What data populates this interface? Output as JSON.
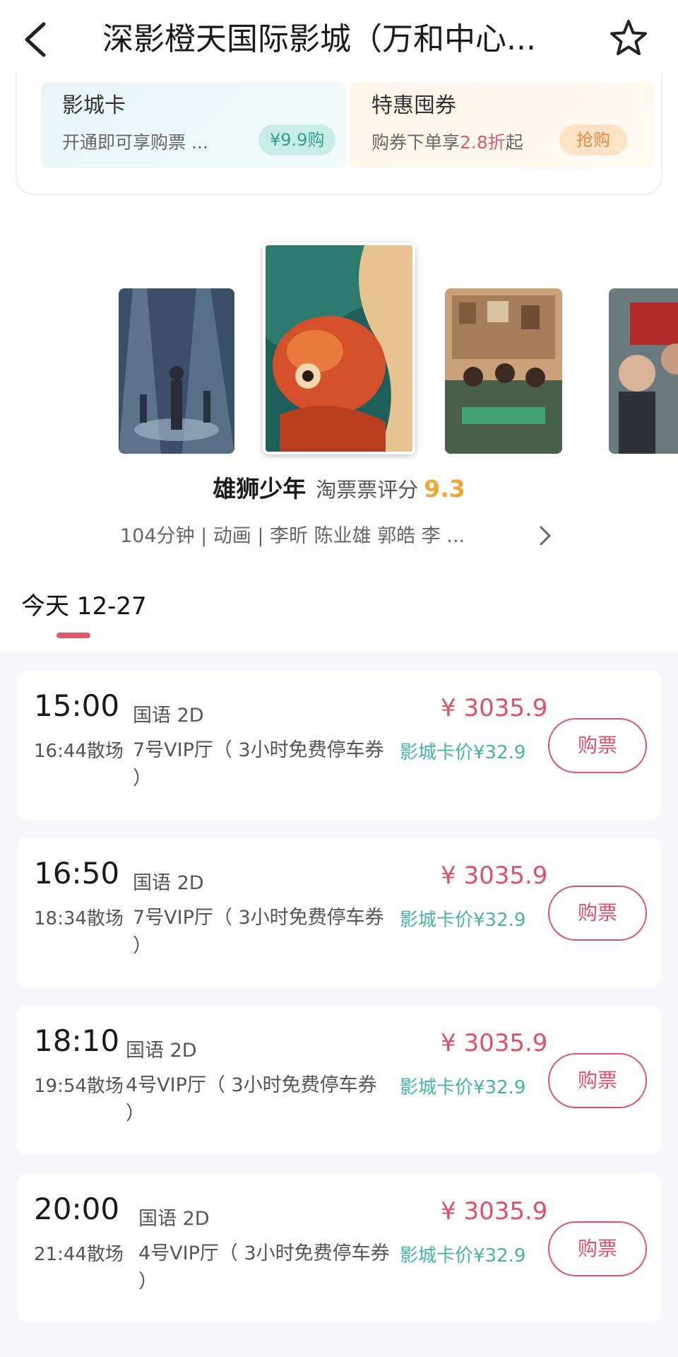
{
  "header": {
    "title": "深影橙天国际影城（万和中心..."
  },
  "promos": [
    {
      "title": "影城卡",
      "desc": "开通即可享购票 ...",
      "button": "¥9.9购"
    },
    {
      "title": "特惠囤券",
      "desc_prefix": "购券下单享",
      "desc_highlight": "2.8折",
      "desc_suffix": "起",
      "button": "抢购"
    }
  ],
  "movie": {
    "name": "雄狮少年",
    "rating_label": "淘票票评分",
    "rating": "9.3",
    "meta": "104分钟 | 动画 | 李昕 陈业雄 郭皓 李 ..."
  },
  "date_tab": "今天 12-27",
  "showtimes": [
    {
      "start": "15:00",
      "end": "16:44散场",
      "lang": "国语 2D",
      "hall": "7号VIP厅（ 3小时免费停车券 ）",
      "price": "¥ 3035.9",
      "card_price": "影城卡价¥32.9",
      "button": "购票"
    },
    {
      "start": "16:50",
      "end": "18:34散场",
      "lang": "国语 2D",
      "hall": "7号VIP厅（ 3小时免费停车券 ）",
      "price": "¥ 3035.9",
      "card_price": "影城卡价¥32.9",
      "button": "购票"
    },
    {
      "start": "18:10",
      "end": "19:54散场",
      "lang": "国语 2D",
      "hall": "4号VIP厅（ 3小时免费停车券 ）",
      "price": "¥ 3035.9",
      "card_price": "影城卡价¥32.9",
      "button": "购票"
    },
    {
      "start": "20:00",
      "end": "21:44散场",
      "lang": "国语 2D",
      "hall": "4号VIP厅（ 3小时免费停车券 ）",
      "price": "¥ 3035.9",
      "card_price": "影城卡价¥32.9",
      "button": "购票"
    }
  ],
  "icons": {
    "back": "chevron-left-icon",
    "favorite": "star-outline-icon",
    "meta_more": "chevron-right-icon"
  },
  "colors": {
    "accent": "#e0506a",
    "rating": "#f2a531",
    "card_price": "#45b3aa"
  }
}
